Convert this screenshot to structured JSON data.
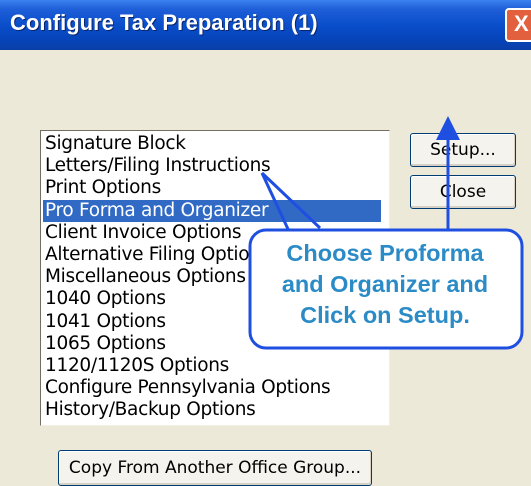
{
  "window": {
    "title": "Configure Tax Preparation (1)",
    "close_glyph": "X"
  },
  "list": {
    "items": [
      "Signature Block",
      "Letters/Filing Instructions",
      "Print Options",
      "Pro Forma and Organizer",
      "Client Invoice Options",
      "Alternative Filing Options",
      "Miscellaneous Options",
      "1040 Options",
      "1041 Options",
      "1065 Options",
      "1120/1120S Options",
      "Configure Pennsylvania Options",
      "History/Backup Options"
    ],
    "selected_index": 3
  },
  "buttons": {
    "setup": "Setup...",
    "close": "Close",
    "copy": "Copy From Another Office Group..."
  },
  "callout": {
    "line1": "Choose Proforma",
    "line2": "and Organizer and",
    "line3": "Click on Setup."
  },
  "colors": {
    "selection": "#316AC5",
    "callout_text": "#2B8BC6",
    "arrow": "#1F4FE0"
  }
}
